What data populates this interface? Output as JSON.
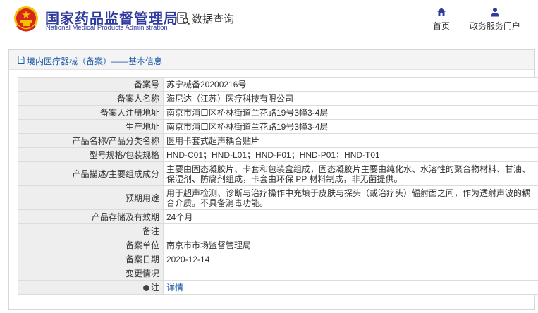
{
  "header": {
    "agency_name_cn": "国家药品监督管理局",
    "agency_name_en": "National Medical Products Administration",
    "emblem_icon": "national-emblem-icon",
    "query_icon": "search-document-icon",
    "query_title": "数据查询",
    "nav": [
      {
        "label": "首页",
        "icon": "home-icon"
      },
      {
        "label": "政务服务门户",
        "icon": "user-icon"
      }
    ]
  },
  "breadcrumb": {
    "icon": "document-icon",
    "text": "境内医疗器械（备案）——基本信息"
  },
  "record": {
    "rows": [
      {
        "label": "备案号",
        "value": "苏宁械备20200216号"
      },
      {
        "label": "备案人名称",
        "value": "海尼达（江苏）医疗科技有限公司"
      },
      {
        "label": "备案人注册地址",
        "value": "南京市浦口区桥林街道兰花路19号3幢3-4层"
      },
      {
        "label": "生产地址",
        "value": "南京市浦口区桥林街道兰花路19号3幢3-4层"
      },
      {
        "label": "产品名称/产品分类名称",
        "value": "医用卡套式超声耦合贴片"
      },
      {
        "label": "型号规格/包装规格",
        "value": "HND-C01；HND-L01；HND-F01；HND-P01；HND-T01"
      },
      {
        "label": "产品描述/主要组成成分",
        "value": "主要由固态凝胶片、卡套和包装盒组成，固态凝胶片主要由纯化水、水溶性的聚合物材料、甘油、保湿剂、防腐剂组成，卡套由环保 PP 材料制成，非无菌提供。"
      },
      {
        "label": "预期用途",
        "value": "用于超声检测、诊断与治疗操作中充填于皮肤与探头（或治疗头）辐射面之间，作为透射声波的耦合介质。不具备消毒功能。"
      },
      {
        "label": "产品存储及有效期",
        "value": "24个月"
      },
      {
        "label": "备注",
        "value": ""
      },
      {
        "label": "备案单位",
        "value": "南京市市场监督管理局"
      },
      {
        "label": "备案日期",
        "value": "2020-12-14"
      },
      {
        "label": "变更情况",
        "value": ""
      },
      {
        "label": "注",
        "value": "详情",
        "icon": "info-dot-icon"
      }
    ]
  },
  "colors": {
    "brand_blue": "#2f3b9c",
    "link_blue": "#1a5aa8",
    "emblem_red": "#d7261e",
    "emblem_gold": "#f2c200"
  }
}
